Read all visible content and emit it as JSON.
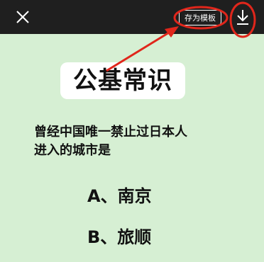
{
  "toolbar": {
    "close_icon": "close-icon",
    "save_template_label": "存为模板",
    "download_icon": "download-icon"
  },
  "content": {
    "title": "公基常识",
    "question_line1": "曾经中国唯一禁止过日本人",
    "question_line2": "进入的城市是",
    "options": [
      {
        "label": "A、南京"
      },
      {
        "label": "B、旅顺"
      }
    ]
  },
  "annotations": {
    "color": "#e0261b"
  },
  "colors": {
    "topbar": "#1f1f1f",
    "background": "#d6efd3",
    "card": "#ffffff",
    "text": "#111111"
  }
}
